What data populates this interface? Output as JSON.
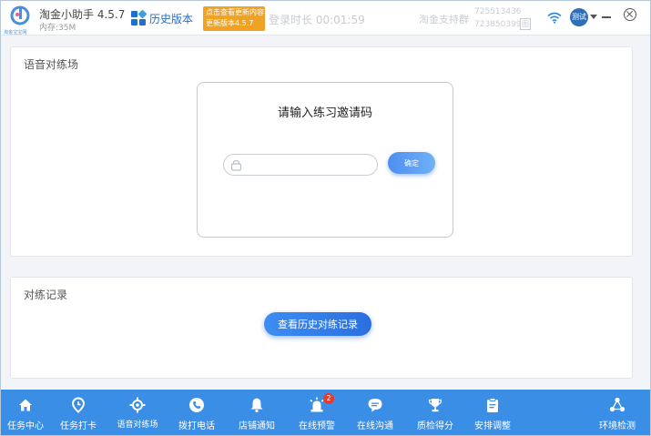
{
  "titlebar": {
    "logo_text": "淘金宝宝网",
    "app_name": "淘金小助手 4.5.7",
    "memory": "内存:35M",
    "history_link": "历史版本",
    "tooltip_line1": "点击查看更新内容",
    "tooltip_line2": "更新版本4.5.7",
    "login_time": "登录时长 00:01:59",
    "support_label": "淘金支持群",
    "phone1": "725513436",
    "phone2": "723850399",
    "copy_glyph": "图",
    "avatar_text": "测试",
    "wifi_icon": "wifi-icon",
    "minimize_icon": "minimize-icon",
    "close_icon": "close-icon"
  },
  "voice_panel": {
    "title": "语音对练场",
    "card_title": "请输入练习邀请码",
    "input_value": "",
    "input_placeholder": "",
    "confirm_label": "确定"
  },
  "record_panel": {
    "title": "对练记录",
    "history_button": "查看历史对练记录"
  },
  "bottom_nav": {
    "items": [
      {
        "label": "任务中心",
        "icon": "home-icon"
      },
      {
        "label": "任务打卡",
        "icon": "location-pin-icon"
      },
      {
        "label": "语音对练场",
        "icon": "target-icon"
      },
      {
        "label": "拨打电话",
        "icon": "phone-icon"
      },
      {
        "label": "店铺通知",
        "icon": "bell-icon"
      },
      {
        "label": "在线预警",
        "icon": "alarm-icon",
        "badge": "2"
      },
      {
        "label": "在线沟通",
        "icon": "chat-icon"
      },
      {
        "label": "质检得分",
        "icon": "trophy-icon"
      },
      {
        "label": "安排调整",
        "icon": "clipboard-icon"
      },
      {
        "label": "环境检测",
        "icon": "network-icon"
      }
    ]
  },
  "colors": {
    "nav_bg": "#3a8ee6",
    "accent": "#1f6fd1",
    "tooltip": "#f0a224",
    "badge": "#e63b2e"
  }
}
